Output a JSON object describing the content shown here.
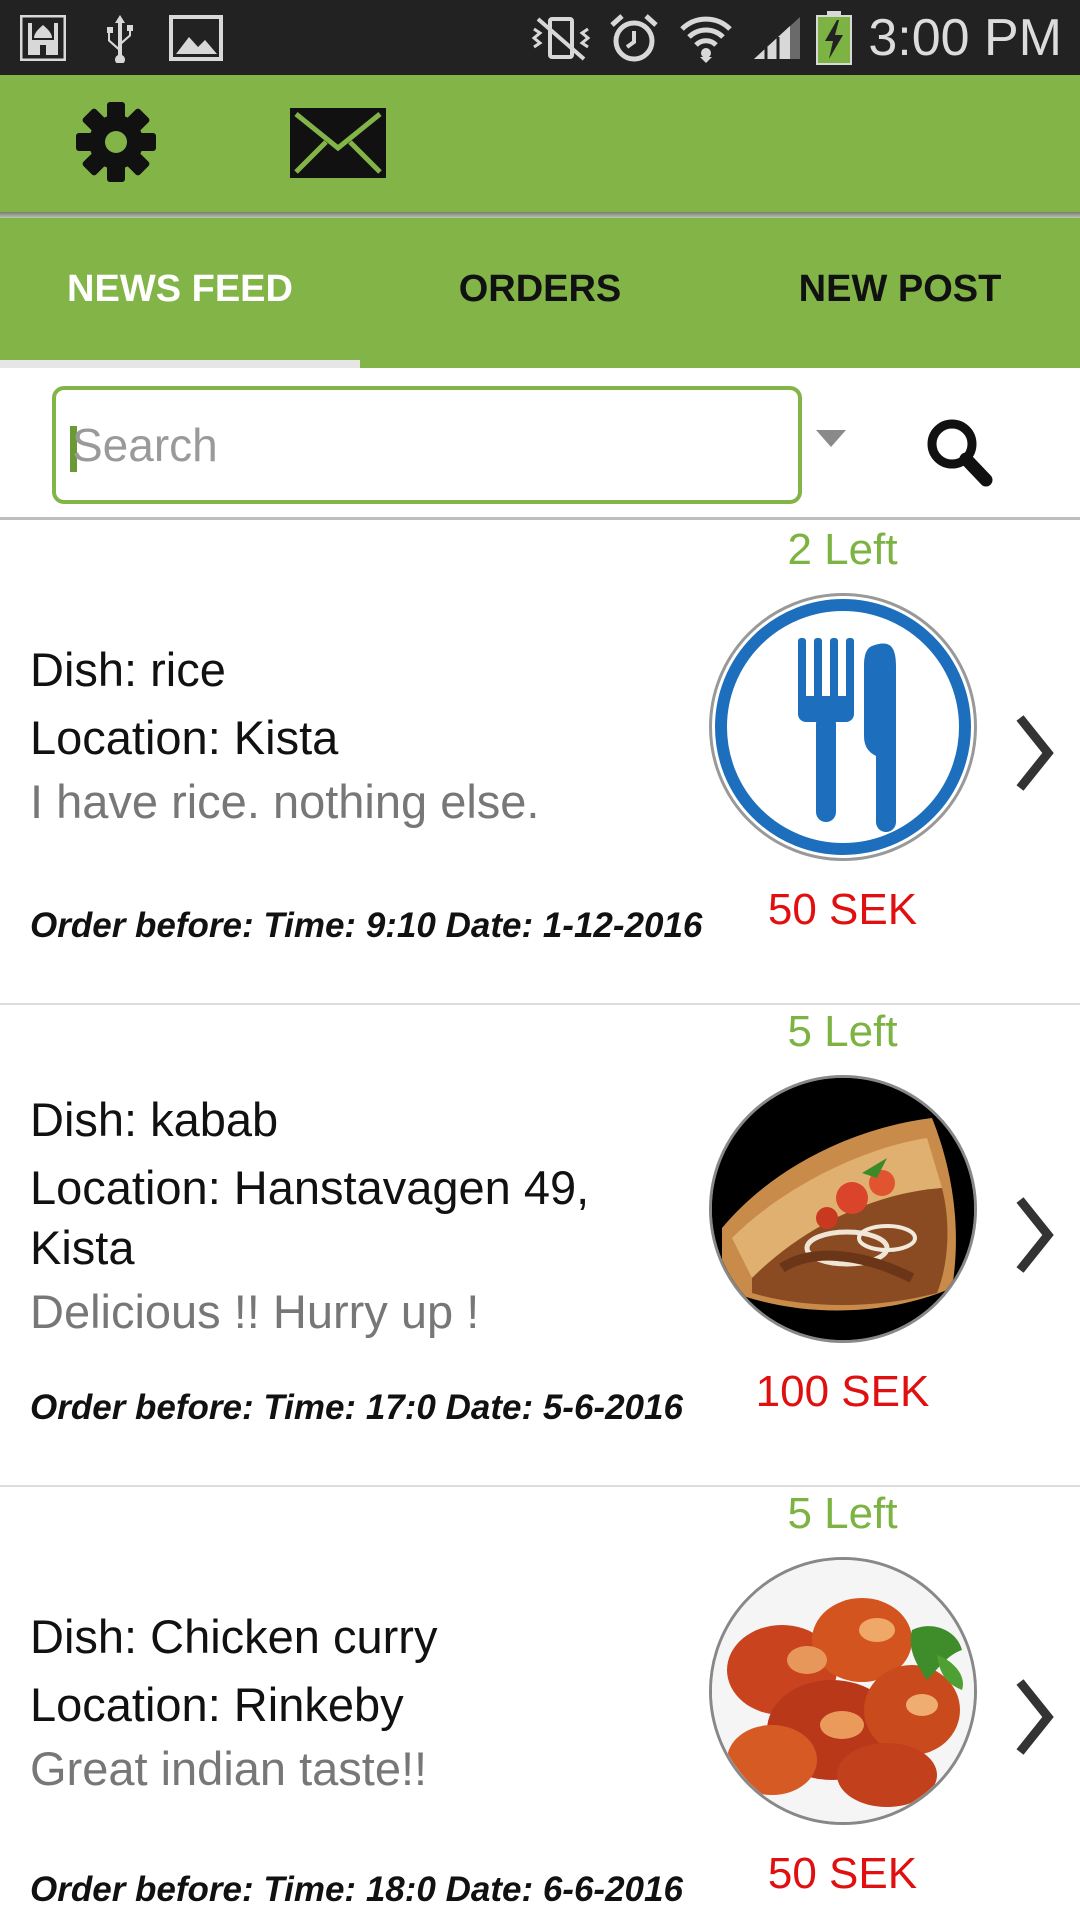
{
  "status_bar": {
    "time": "3:00 PM",
    "icons": [
      "mosque-icon",
      "usb-icon",
      "image-icon",
      "vibrate-off-icon",
      "alarm-icon",
      "wifi-icon",
      "signal-icon",
      "battery-charging-icon"
    ]
  },
  "action_bar": {
    "icons": [
      "gear-icon",
      "envelope-icon"
    ]
  },
  "tabs": [
    {
      "label": "NEWS FEED",
      "active": true
    },
    {
      "label": "ORDERS",
      "active": false
    },
    {
      "label": "NEW POST",
      "active": false
    }
  ],
  "search": {
    "placeholder": "Search",
    "value": ""
  },
  "posts": [
    {
      "left_count": "2 Left",
      "dish": "Dish: rice",
      "location": "Location: Kista",
      "description": "I have rice. nothing else.",
      "order_before": "Order before: Time: 9:10 Date: 1-12-2016",
      "price": "50 SEK",
      "image": "fork-knife-icon"
    },
    {
      "left_count": "5 Left",
      "dish": "Dish: kabab",
      "location": "Location: Hanstavagen 49, Kista",
      "description": "Delicious !! Hurry up !",
      "order_before": "Order before: Time: 17:0 Date: 5-6-2016",
      "price": "100 SEK",
      "image": "kabab-photo"
    },
    {
      "left_count": "5 Left",
      "dish": "Dish: Chicken curry",
      "location": "Location: Rinkeby",
      "description": "Great indian taste!!",
      "order_before": "Order before: Time: 18:0 Date: 6-6-2016",
      "price": "50 SEK",
      "image": "chicken-curry-photo"
    }
  ],
  "colors": {
    "accent_green": "#82b448",
    "left_count_green": "#7cb342",
    "price_red": "#e01010",
    "status_bar": "#222222"
  }
}
